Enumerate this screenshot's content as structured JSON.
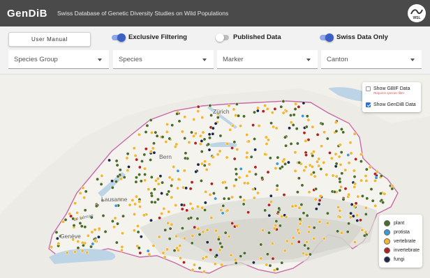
{
  "header": {
    "brand": "GenDiB",
    "subtitle": "Swiss Database of Genetic Diversity Studies on Wild Populations",
    "logo_text": "WSL"
  },
  "controls": {
    "manual_button": "User Manual",
    "toggles": [
      {
        "label": "Exclusive Filtering",
        "state": "on"
      },
      {
        "label": "Published Data",
        "state": "off"
      },
      {
        "label": "Swiss Data Only",
        "state": "on"
      }
    ],
    "selects": [
      {
        "label": "Species Group"
      },
      {
        "label": "Species"
      },
      {
        "label": "Marker"
      },
      {
        "label": "Canton"
      }
    ],
    "accent_color": "#3b5fc4"
  },
  "map": {
    "places": [
      "Zürich",
      "Bern",
      "Lausanne",
      "Genève"
    ],
    "lake_label": "Le Léman"
  },
  "layers": {
    "gbif_label": "Show GBIF Data",
    "gbif_checked": false,
    "gbif_note": "Requires species filter",
    "gendib_label": "Show GenDiB Data",
    "gendib_checked": true
  },
  "legend": [
    {
      "label": "plant",
      "color": "#4a6b2a"
    },
    {
      "label": "protista",
      "color": "#3a9ad9"
    },
    {
      "label": "vertebrate",
      "color": "#f2b632"
    },
    {
      "label": "invertebrate",
      "color": "#b22222"
    },
    {
      "label": "fungi",
      "color": "#1b2a4a"
    }
  ]
}
